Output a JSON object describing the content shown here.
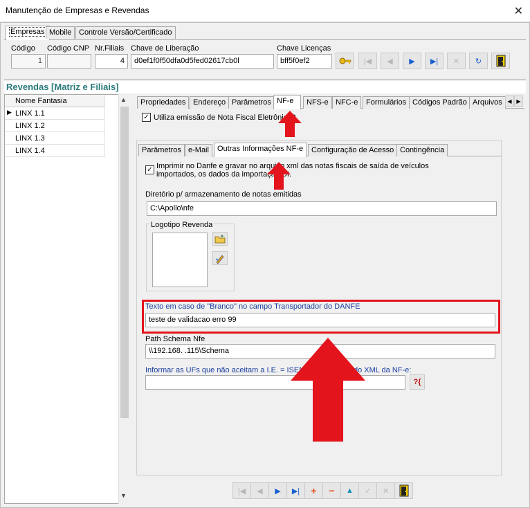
{
  "window": {
    "title": "Manutenção de Empresas e Revendas",
    "close": "✕"
  },
  "top_tabs": [
    "Empresas",
    "Mobile",
    "Controle Versão/Certificado"
  ],
  "fields": {
    "codigo": {
      "label": "Código",
      "value": "1"
    },
    "codigo_cnp": {
      "label": "Código CNP",
      "value": ""
    },
    "nr_filiais": {
      "label": "Nr.Filiais",
      "value": "4"
    },
    "chave_liberacao": {
      "label": "Chave de Liberação",
      "value": "d0ef1f0f50dfa0d5fed02617cb0l"
    },
    "chave_licencas": {
      "label": "Chave Licenças",
      "value": "bff5f0ef2"
    }
  },
  "revendas": {
    "header": "Revendas [Matriz e Filiais]",
    "column": "Nome Fantasia",
    "rows": [
      "LINX 1.1",
      "LINX 1.2",
      "LINX 1.3",
      "LINX 1.4"
    ]
  },
  "right_tabs": [
    "Propriedades",
    "Endereço",
    "Parâmetros",
    "NF-e",
    "NFS-e",
    "NFC-e",
    "Formulários",
    "Códigos Padrão",
    "Arquivos"
  ],
  "utiliza_nfe": "Utiliza emissão de Nota Fiscal Eletrônica?",
  "sub_tabs": [
    "Parâmetros",
    "e-Mail",
    "Outras Informações NF-e",
    "Configuração de Acesso",
    "Contingência"
  ],
  "imprimir_danfe": "Imprimir no Danfe e gravar no arquivo xml das notas fiscais de saída de veículos importados, os dados da importação DI.",
  "diretorio": {
    "label": "Diretório p/ armazenamento de notas emitidas",
    "value": "C:\\Apollo\\nfe"
  },
  "logotipo": "Logotipo Revenda",
  "texto_branco": {
    "label": "Texto em caso de \"Branco\" no campo Transportador do DANFE",
    "value": "teste de validacao erro 99"
  },
  "path_schema": {
    "label": "Path Schema Nfe",
    "value": "\\\\192.168.     .115\\Schema"
  },
  "ufs": {
    "label": "Informar as UFs que não aceitam a I.E. = ISENTO",
    "label_tail": "do XML da NF-e:",
    "value": ""
  },
  "colors": {
    "accent_red": "#e3141c",
    "teal": "#2a7a7a",
    "link_blue": "#1a3f9e"
  }
}
